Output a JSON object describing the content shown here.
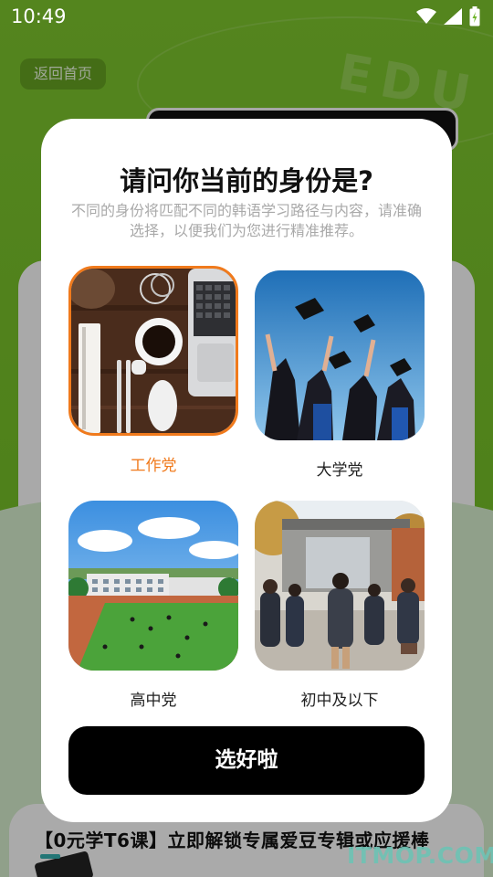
{
  "status_bar": {
    "time": "10:49"
  },
  "background": {
    "back_button": "返回首页",
    "watermark_text": "EDU",
    "bottom_banner": "【0元学T6课】立即解锁专属爱豆专辑或应援棒"
  },
  "modal": {
    "title": "请问你当前的身份是?",
    "subtitle": "不同的身份将匹配不同的韩语学习路径与内容，请准确选择，以便我们为您进行精准推荐。",
    "options": [
      {
        "label": "工作党",
        "selected": true,
        "image": "desk-with-coffee-laptop-photo"
      },
      {
        "label": "大学党",
        "selected": false,
        "image": "graduation-caps-thrown-photo"
      },
      {
        "label": "高中党",
        "selected": false,
        "image": "school-sports-field-illustration"
      },
      {
        "label": "初中及以下",
        "selected": false,
        "image": "students-walking-to-school-photo"
      }
    ],
    "confirm_label": "选好啦"
  },
  "site_watermark": "ITMOP.COM",
  "colors": {
    "accent": "#f07a1c",
    "brand_green": "#6fb52a",
    "button": "#000000"
  }
}
